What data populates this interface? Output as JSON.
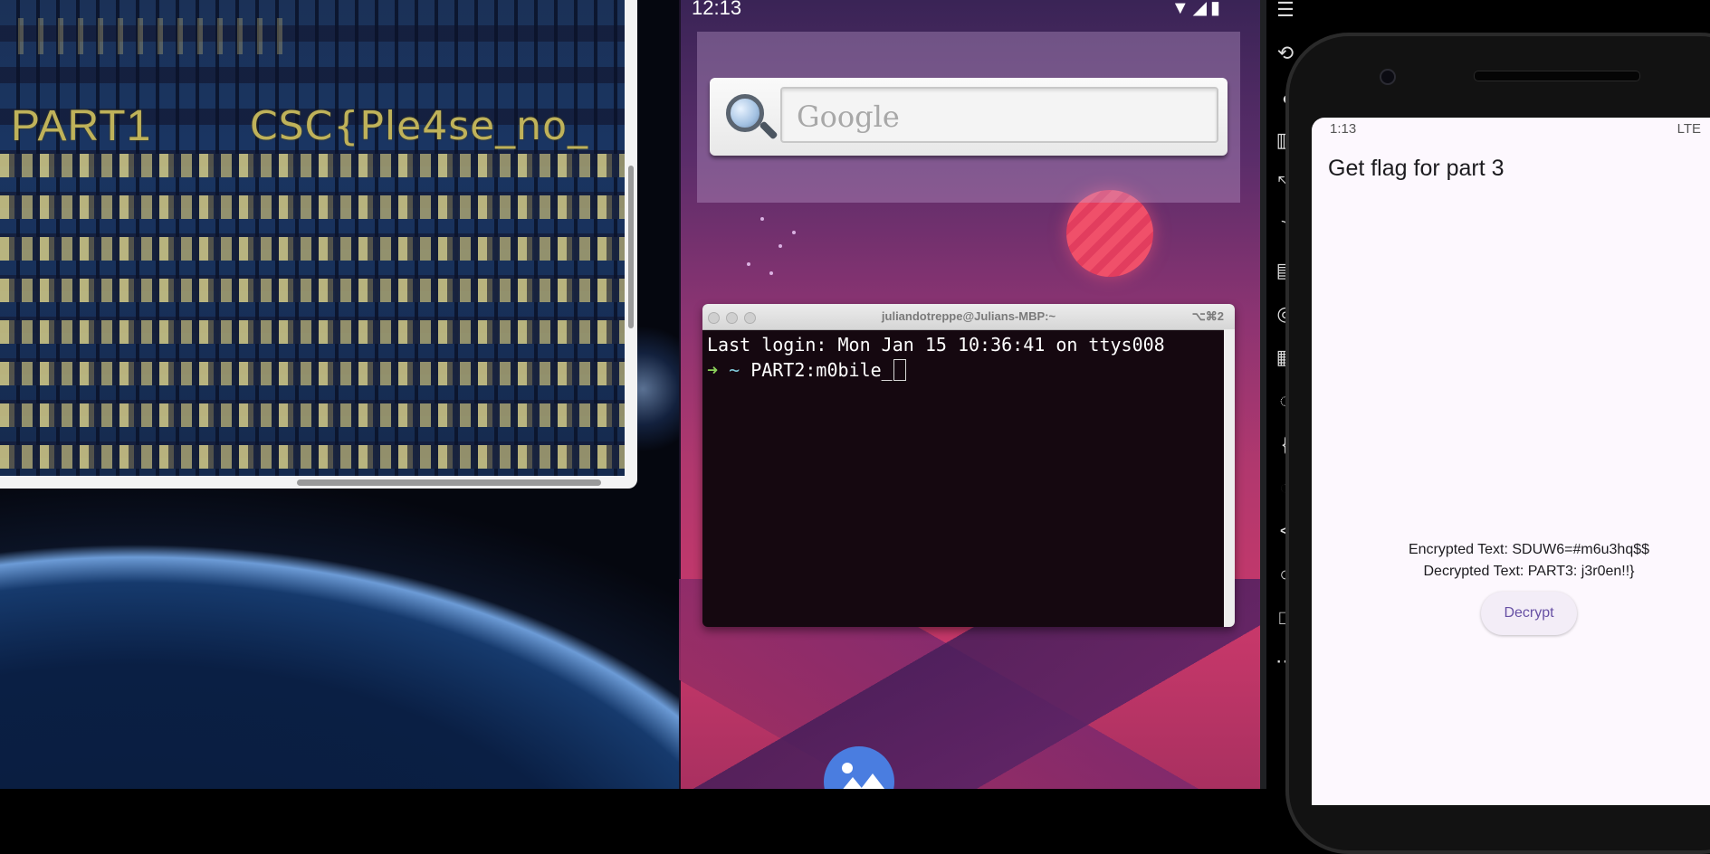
{
  "image_viewer": {
    "photo_text_part": "PART1",
    "photo_text_flag": "CSC{Ple4se_no_"
  },
  "android_home": {
    "clock": "12:13",
    "status_icons": "▼◢▮",
    "search_placeholder": "Google"
  },
  "terminal": {
    "title": "juliandotreppe@Julians-MBP:~",
    "shortcut": "⌥⌘2",
    "line1": "Last login: Mon Jan 15 10:36:41 on ttys008",
    "prompt_arrow": "➜",
    "prompt_dir": "~",
    "command": "PART2:m0bile_"
  },
  "emulator_toolbar": {
    "icons": [
      "menu-icon",
      "rotate-icon",
      "volume-icon",
      "screenshot-icon",
      "fullscreen-icon",
      "cast-icon",
      "camera-icon",
      "gps-icon",
      "layout-icon",
      "fingerprint-icon",
      "code-icon",
      "google-api-icon",
      "back-icon",
      "home-icon",
      "overview-icon",
      "more-icon"
    ]
  },
  "emulator": {
    "status_time": "1:13",
    "status_network": "LTE",
    "app_title": "Get flag for part 3",
    "encrypted_text": "Encrypted Text: SDUW6=#m6u3hq$$",
    "decrypted_text": "Decrypted Text: PART3: j3r0en!!}",
    "decrypt_button": "Decrypt"
  },
  "colors": {
    "terminal_bg": "#150810",
    "prompt_arrow": "#8bd15a",
    "button_text": "#6750a4",
    "photo_text": "#bfb25a"
  }
}
